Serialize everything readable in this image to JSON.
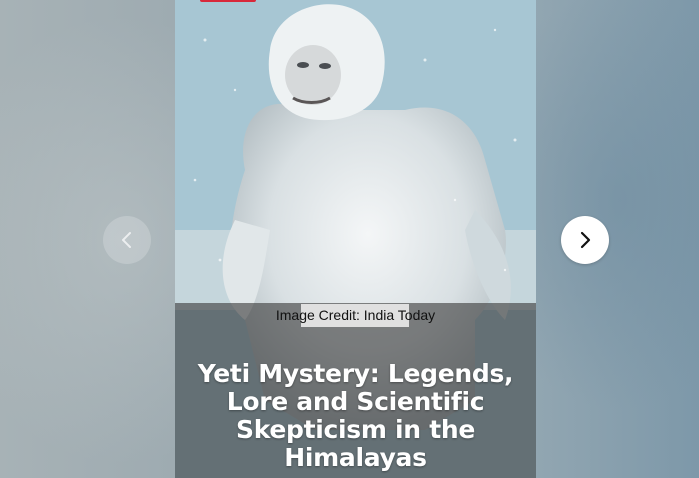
{
  "story": {
    "image_alt": "White yeti creature in snowy mountains",
    "image_credit": "Image Credit: India Today",
    "title": "Yeti Mystery: Legends, Lore and Scientific Skepticism in the Himalayas"
  },
  "navigation": {
    "previous_icon": "chevron-left-icon",
    "next_icon": "chevron-right-icon"
  },
  "colors": {
    "badge": "#d8283a",
    "overlay": "#3c3c3c",
    "title_text": "#ffffff"
  }
}
